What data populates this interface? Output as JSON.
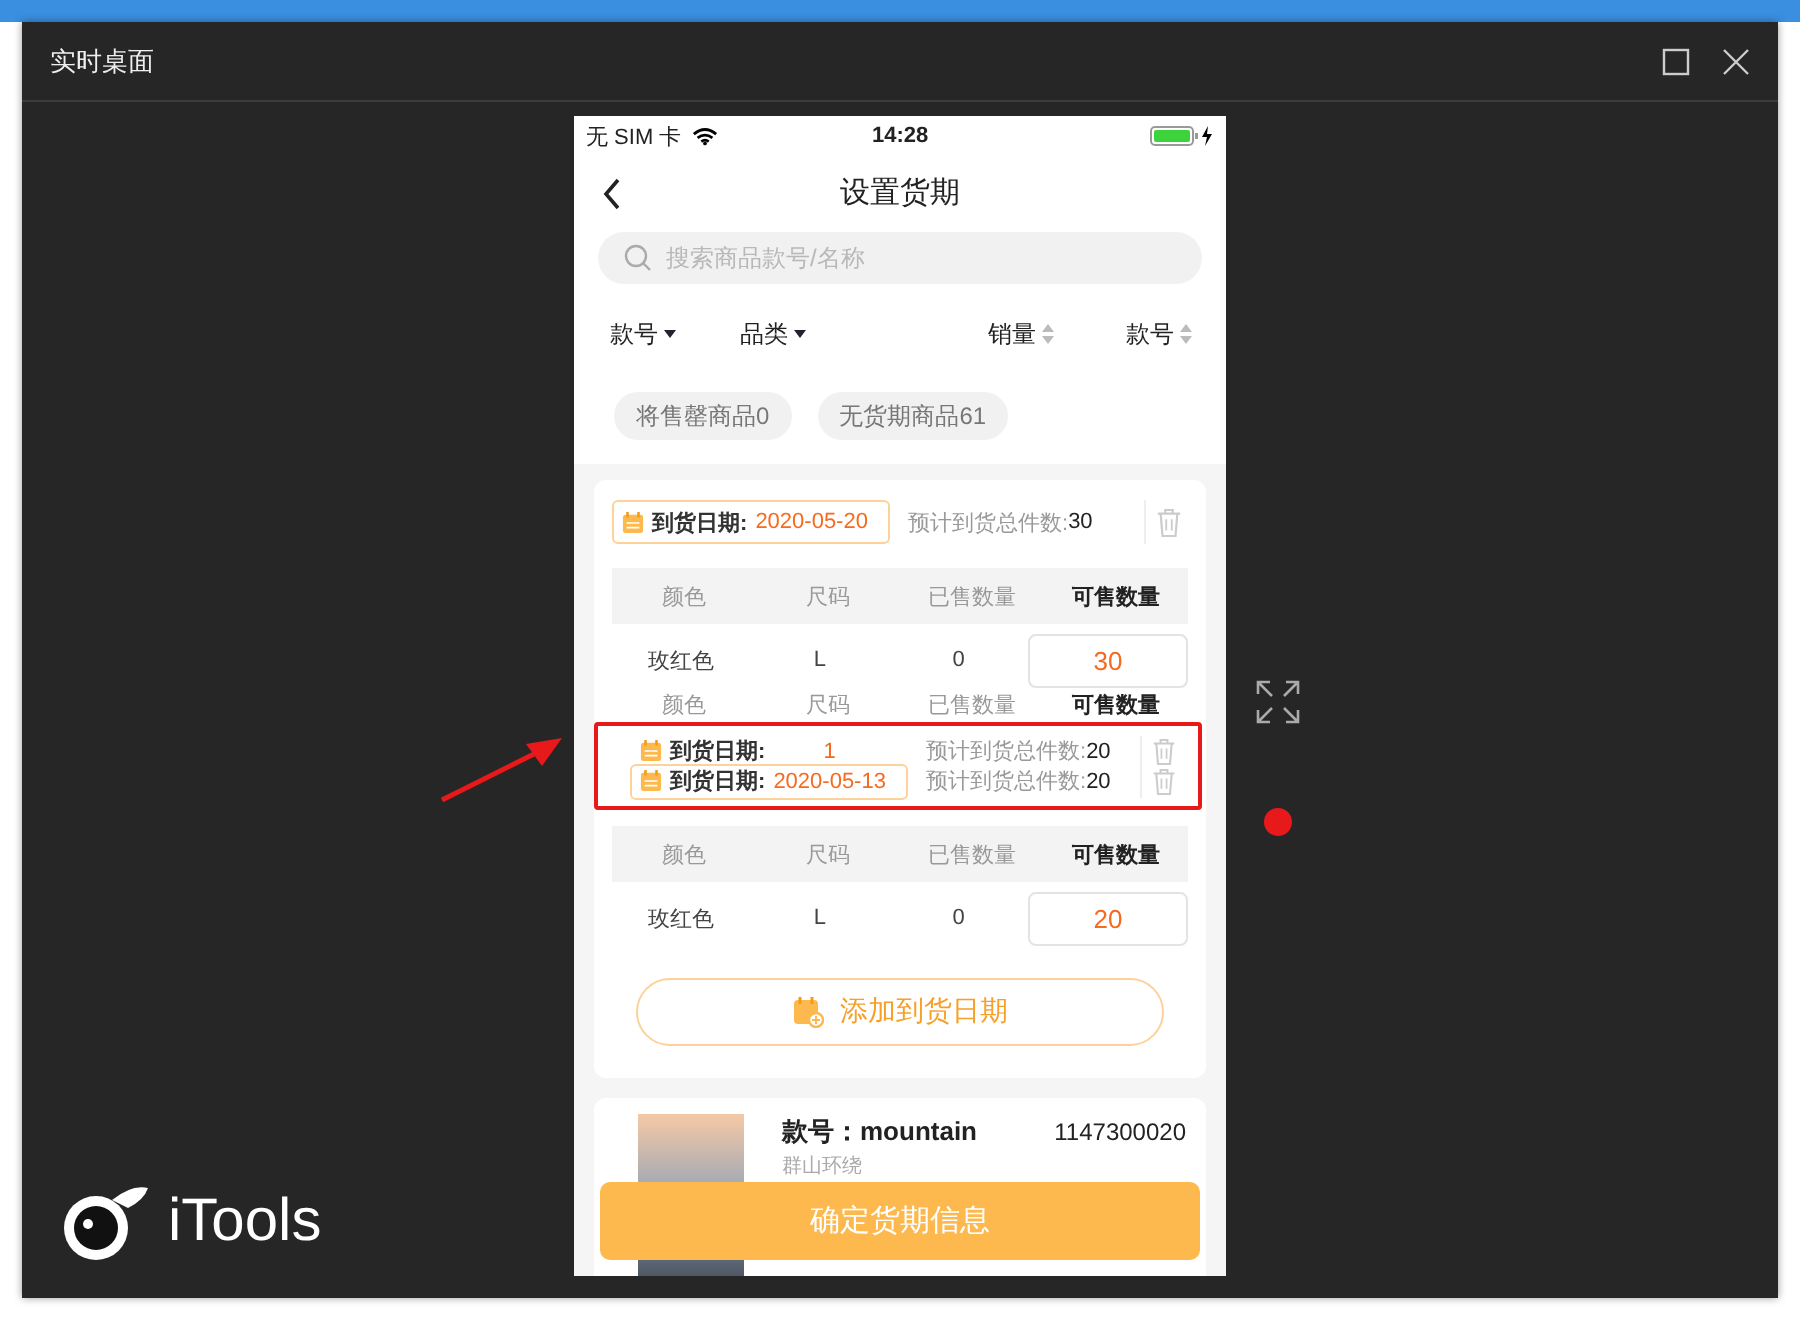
{
  "window": {
    "title": "实时桌面"
  },
  "phone": {
    "status_bar": {
      "carrier": "无 SIM 卡",
      "time": "14:28"
    },
    "nav": {
      "title": "设置货期"
    },
    "search": {
      "placeholder": "搜索商品款号/名称"
    },
    "sort_options": [
      {
        "label": "款号",
        "kind": "dropdown"
      },
      {
        "label": "品类",
        "kind": "dropdown"
      },
      {
        "label": "销量",
        "kind": "sort"
      },
      {
        "label": "款号",
        "kind": "sort"
      }
    ],
    "filter_chips": [
      {
        "label": "将售罄商品0",
        "selected": false
      },
      {
        "label": "无货期商品61",
        "selected": false
      }
    ],
    "card": {
      "rows": [
        {
          "kind": "date",
          "label": "到货日期:",
          "date": "2020-05-20",
          "total_label": "预计到货总件数:",
          "total": "30",
          "pill": true
        },
        {
          "kind": "header",
          "shaded": true,
          "cells": [
            "颜色",
            "尺码",
            "已售数量",
            "可售数量"
          ]
        },
        {
          "kind": "item",
          "cells": [
            "玫红色",
            "L",
            "0"
          ],
          "available": "30"
        },
        {
          "kind": "header",
          "shaded": false,
          "cells": [
            "颜色",
            "尺码",
            "已售数量",
            "可售数量"
          ]
        },
        {
          "kind": "highlight",
          "lines": [
            {
              "label": "到货日期:",
              "date": "1",
              "total_label": "预计到货总件数:",
              "total": "20",
              "pill": false
            },
            {
              "label": "到货日期:",
              "date": "2020-05-13",
              "total_label": "预计到货总件数:",
              "total": "20",
              "pill": true
            }
          ]
        },
        {
          "kind": "header",
          "shaded": true,
          "cells": [
            "颜色",
            "尺码",
            "已售数量",
            "可售数量"
          ]
        },
        {
          "kind": "item",
          "cells": [
            "玫红色",
            "L",
            "0"
          ],
          "available": "20"
        }
      ],
      "add_button": "添加到货日期"
    },
    "product": {
      "code_label": "款号：",
      "code": "mountain",
      "number": "1147300020",
      "subtitle": "群山环绕"
    },
    "confirm_button": "确定货期信息"
  },
  "logo": {
    "text": "iTools"
  }
}
